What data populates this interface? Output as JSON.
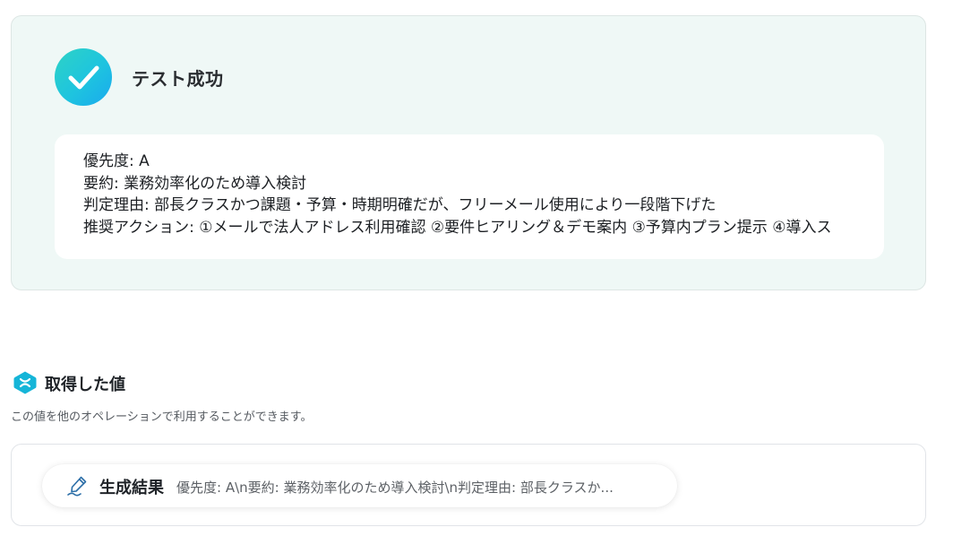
{
  "success": {
    "title": "テスト成功",
    "icon": "check-icon",
    "accent_gradient": [
      "#2ed3c5",
      "#1aa9ee"
    ],
    "result_lines": [
      "優先度: A",
      "要約: 業務効率化のため導入検討",
      "判定理由: 部長クラスかつ課題・予算・時期明確だが、フリーメール使用により一段階下げた",
      "推奨アクション: ①メールで法人アドレス利用確認 ②要件ヒアリング＆デモ案内 ③予算内プラン提示 ④導入ス"
    ]
  },
  "acquired": {
    "title": "取得した値",
    "icon": "yoom-hexagon-icon",
    "icon_color": "#15b5d8",
    "description": "この値を他のオペレーションで利用することができます。",
    "chip": {
      "icon": "pen-icon",
      "label": "生成結果",
      "value": "優先度: A\\n要約: 業務効率化のため導入検討\\n判定理由: 部長クラスか..."
    }
  }
}
